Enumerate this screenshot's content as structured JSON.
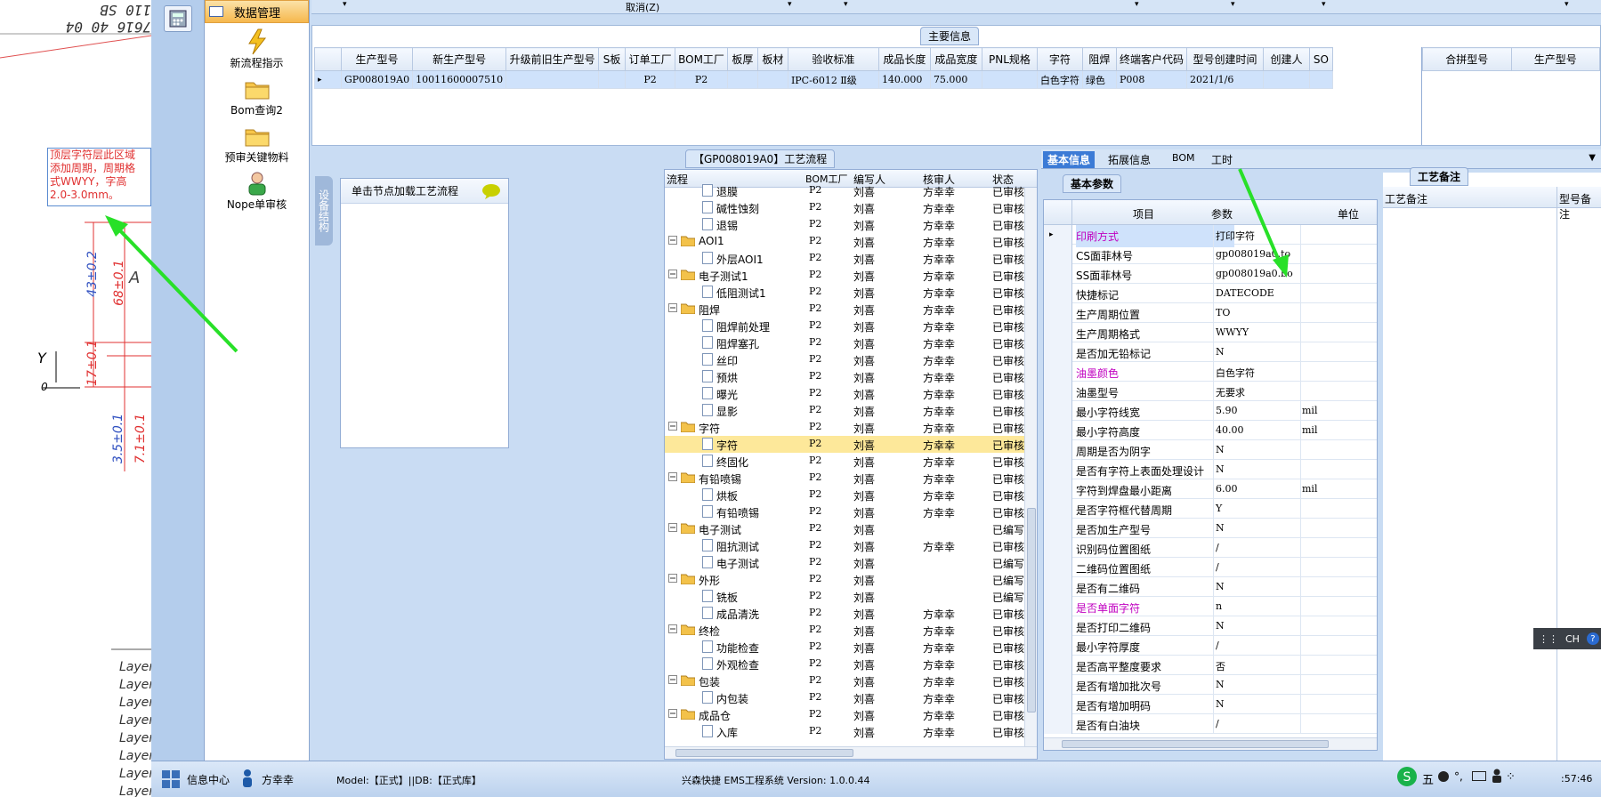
{
  "cad": {
    "top_text": "7616 40 04 110 SB",
    "note_lines": [
      "顶层字符层此区域",
      "添加周期，周期格",
      "式WWYY，字高",
      "2.0-3.0mm。"
    ],
    "dims": [
      "43±0.2",
      "68±0.1",
      "17±0.1",
      "3.5±0.1",
      "7.1±0.1"
    ],
    "letters": [
      "A",
      "Y",
      "0"
    ],
    "layers": [
      "Layer",
      "Layer",
      "Layer",
      "Layer",
      "Layer",
      "Layer",
      "Layer",
      "Layer"
    ]
  },
  "sidenav": {
    "header": "数据管理",
    "items": [
      {
        "label": "新流程指示",
        "icon": "lightning-icon"
      },
      {
        "label": "Bom查询2",
        "icon": "folder-icon"
      },
      {
        "label": "预审关键物料",
        "icon": "folder-icon"
      },
      {
        "label": "Nope单审核",
        "icon": "user-icon"
      }
    ]
  },
  "topbar": {
    "cancel": "取消(Z)"
  },
  "main_info": {
    "title": "主要信息",
    "columns": [
      "生产型号",
      "新生产型号",
      "升级前旧生产型号",
      "S板",
      "订单工厂",
      "BOM工厂",
      "板厚",
      "板材",
      "验收标准",
      "成品长度",
      "成品宽度",
      "PNL规格",
      "字符",
      "阻焊",
      "终端客户代码",
      "型号创建时间",
      "创建人",
      "SO"
    ],
    "row": [
      "GP008019A0",
      "10011600007510",
      "",
      "",
      "P2",
      "P2",
      "",
      "",
      "IPC-6012 Ⅱ级",
      "140.000",
      "75.000",
      "",
      "白色字符",
      "绿色",
      "P008",
      "2021/1/6",
      "",
      ""
    ],
    "merge_columns": [
      "合拼型号",
      "生产型号"
    ]
  },
  "process": {
    "title": "【GP008019A0】工艺流程",
    "side_tab": "设备结构",
    "load_label": "单击节点加载工艺流程",
    "columns": [
      "流程",
      "BOM工厂",
      "编写人",
      "核审人",
      "状态"
    ],
    "rows": [
      {
        "level": 2,
        "name": "退膜",
        "bom": "P2",
        "writer": "刘喜",
        "reviewer": "方幸幸",
        "status": "已审核"
      },
      {
        "level": 2,
        "name": "碱性蚀刻",
        "bom": "P2",
        "writer": "刘喜",
        "reviewer": "方幸幸",
        "status": "已审核"
      },
      {
        "level": 2,
        "name": "退锡",
        "bom": "P2",
        "writer": "刘喜",
        "reviewer": "方幸幸",
        "status": "已审核"
      },
      {
        "level": 1,
        "name": "AOI1",
        "bom": "P2",
        "writer": "刘喜",
        "reviewer": "方幸幸",
        "status": "已审核"
      },
      {
        "level": 2,
        "name": "外层AOI1",
        "bom": "P2",
        "writer": "刘喜",
        "reviewer": "方幸幸",
        "status": "已审核"
      },
      {
        "level": 1,
        "name": "电子测试1",
        "bom": "P2",
        "writer": "刘喜",
        "reviewer": "方幸幸",
        "status": "已审核"
      },
      {
        "level": 2,
        "name": "低阻测试1",
        "bom": "P2",
        "writer": "刘喜",
        "reviewer": "方幸幸",
        "status": "已审核"
      },
      {
        "level": 1,
        "name": "阻焊",
        "bom": "P2",
        "writer": "刘喜",
        "reviewer": "方幸幸",
        "status": "已审核"
      },
      {
        "level": 2,
        "name": "阻焊前处理",
        "bom": "P2",
        "writer": "刘喜",
        "reviewer": "方幸幸",
        "status": "已审核"
      },
      {
        "level": 2,
        "name": "阻焊塞孔",
        "bom": "P2",
        "writer": "刘喜",
        "reviewer": "方幸幸",
        "status": "已审核"
      },
      {
        "level": 2,
        "name": "丝印",
        "bom": "P2",
        "writer": "刘喜",
        "reviewer": "方幸幸",
        "status": "已审核"
      },
      {
        "level": 2,
        "name": "预烘",
        "bom": "P2",
        "writer": "刘喜",
        "reviewer": "方幸幸",
        "status": "已审核"
      },
      {
        "level": 2,
        "name": "曝光",
        "bom": "P2",
        "writer": "刘喜",
        "reviewer": "方幸幸",
        "status": "已审核"
      },
      {
        "level": 2,
        "name": "显影",
        "bom": "P2",
        "writer": "刘喜",
        "reviewer": "方幸幸",
        "status": "已审核"
      },
      {
        "level": 1,
        "name": "字符",
        "bom": "P2",
        "writer": "刘喜",
        "reviewer": "方幸幸",
        "status": "已审核"
      },
      {
        "level": 2,
        "name": "字符",
        "bom": "P2",
        "writer": "刘喜",
        "reviewer": "方幸幸",
        "status": "已审核",
        "selected": true
      },
      {
        "level": 2,
        "name": "终固化",
        "bom": "P2",
        "writer": "刘喜",
        "reviewer": "方幸幸",
        "status": "已审核"
      },
      {
        "level": 1,
        "name": "有铅喷锡",
        "bom": "P2",
        "writer": "刘喜",
        "reviewer": "方幸幸",
        "status": "已审核"
      },
      {
        "level": 2,
        "name": "烘板",
        "bom": "P2",
        "writer": "刘喜",
        "reviewer": "方幸幸",
        "status": "已审核"
      },
      {
        "level": 2,
        "name": "有铅喷锡",
        "bom": "P2",
        "writer": "刘喜",
        "reviewer": "方幸幸",
        "status": "已审核"
      },
      {
        "level": 1,
        "name": "电子测试",
        "bom": "P2",
        "writer": "刘喜",
        "reviewer": "",
        "status": "已编写"
      },
      {
        "level": 2,
        "name": "阻抗测试",
        "bom": "P2",
        "writer": "刘喜",
        "reviewer": "方幸幸",
        "status": "已审核"
      },
      {
        "level": 2,
        "name": "电子测试",
        "bom": "P2",
        "writer": "刘喜",
        "reviewer": "",
        "status": "已编写"
      },
      {
        "level": 1,
        "name": "外形",
        "bom": "P2",
        "writer": "刘喜",
        "reviewer": "",
        "status": "已编写"
      },
      {
        "level": 2,
        "name": "铣板",
        "bom": "P2",
        "writer": "刘喜",
        "reviewer": "",
        "status": "已编写"
      },
      {
        "level": 2,
        "name": "成品清洗",
        "bom": "P2",
        "writer": "刘喜",
        "reviewer": "方幸幸",
        "status": "已审核"
      },
      {
        "level": 1,
        "name": "终检",
        "bom": "P2",
        "writer": "刘喜",
        "reviewer": "方幸幸",
        "status": "已审核"
      },
      {
        "level": 2,
        "name": "功能检查",
        "bom": "P2",
        "writer": "刘喜",
        "reviewer": "方幸幸",
        "status": "已审核"
      },
      {
        "level": 2,
        "name": "外观检查",
        "bom": "P2",
        "writer": "刘喜",
        "reviewer": "方幸幸",
        "status": "已审核"
      },
      {
        "level": 1,
        "name": "包装",
        "bom": "P2",
        "writer": "刘喜",
        "reviewer": "方幸幸",
        "status": "已审核"
      },
      {
        "level": 2,
        "name": "内包装",
        "bom": "P2",
        "writer": "刘喜",
        "reviewer": "方幸幸",
        "status": "已审核"
      },
      {
        "level": 1,
        "name": "成品仓",
        "bom": "P2",
        "writer": "刘喜",
        "reviewer": "方幸幸",
        "status": "已审核"
      },
      {
        "level": 2,
        "name": "入库",
        "bom": "P2",
        "writer": "刘喜",
        "reviewer": "方幸幸",
        "status": "已审核"
      }
    ]
  },
  "info": {
    "tabs": [
      "基本信息",
      "拓展信息",
      "BOM",
      "工时"
    ],
    "basic_tab": "基本参数",
    "remark_tab": "工艺备注",
    "columns": [
      "项目",
      "参数",
      "单位"
    ],
    "remark_columns": [
      "工艺备注",
      "型号备注"
    ],
    "params": [
      {
        "item": "印刷方式",
        "value": "打印字符",
        "unit": "",
        "color": "#c000c0",
        "selected": true
      },
      {
        "item": "CS面菲林号",
        "value": "gp008019a0.to",
        "unit": ""
      },
      {
        "item": "SS面菲林号",
        "value": "gp008019a0.bo",
        "unit": ""
      },
      {
        "item": "快捷标记",
        "value": "DATECODE",
        "unit": ""
      },
      {
        "item": "生产周期位置",
        "value": "TO",
        "unit": ""
      },
      {
        "item": "生产周期格式",
        "value": "WWYY",
        "unit": ""
      },
      {
        "item": "是否加无铅标记",
        "value": "N",
        "unit": ""
      },
      {
        "item": "油墨颜色",
        "value": "白色字符",
        "unit": "",
        "color": "#c000c0"
      },
      {
        "item": "油墨型号",
        "value": "无要求",
        "unit": ""
      },
      {
        "item": "最小字符线宽",
        "value": "5.90",
        "unit": "mil"
      },
      {
        "item": "最小字符高度",
        "value": "40.00",
        "unit": "mil"
      },
      {
        "item": "周期是否为阴字",
        "value": "N",
        "unit": ""
      },
      {
        "item": "是否有字符上表面处理设计",
        "value": "N",
        "unit": ""
      },
      {
        "item": "字符到焊盘最小距离",
        "value": "6.00",
        "unit": "mil"
      },
      {
        "item": "是否字符框代替周期",
        "value": "Y",
        "unit": ""
      },
      {
        "item": "是否加生产型号",
        "value": "N",
        "unit": ""
      },
      {
        "item": "识别码位置图纸",
        "value": "/",
        "unit": ""
      },
      {
        "item": "二维码位置图纸",
        "value": "/",
        "unit": ""
      },
      {
        "item": "是否有二维码",
        "value": "N",
        "unit": ""
      },
      {
        "item": "是否单面字符",
        "value": "n",
        "unit": "",
        "color": "#c000c0"
      },
      {
        "item": "是否打印二维码",
        "value": "N",
        "unit": ""
      },
      {
        "item": "最小字符厚度",
        "value": "/",
        "unit": ""
      },
      {
        "item": "是否高平整度要求",
        "value": "否",
        "unit": ""
      },
      {
        "item": "是否有增加批次号",
        "value": "N",
        "unit": ""
      },
      {
        "item": "是否有增加明码",
        "value": "N",
        "unit": ""
      },
      {
        "item": "是否有白油块",
        "value": "/",
        "unit": ""
      }
    ]
  },
  "status": {
    "info_center": "信息中心",
    "user": "方幸幸",
    "model": "Model:【正式】||DB:【正式库】",
    "version": "兴森快捷 EMS工程系统 Version: 1.0.0.44",
    "clock": ":57:46",
    "ime": "CH",
    "tray_text": "五"
  }
}
